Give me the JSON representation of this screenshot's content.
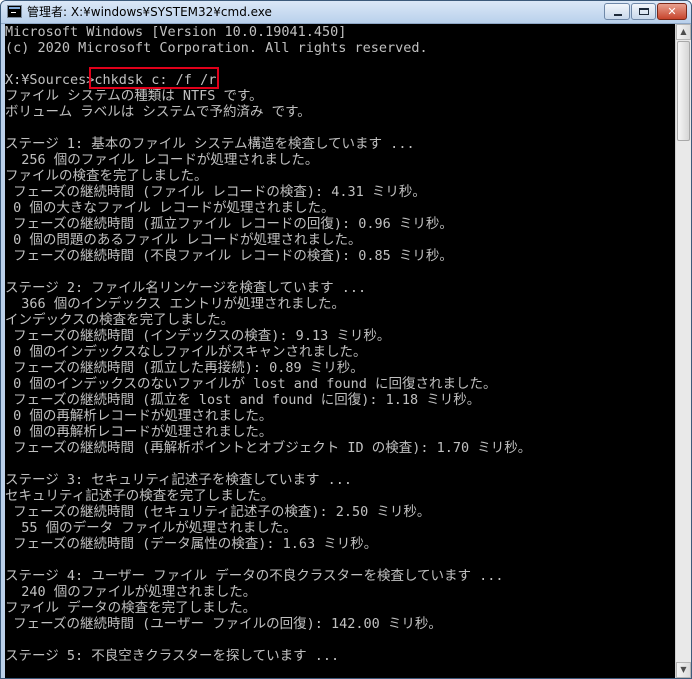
{
  "window": {
    "title": "管理者: X:¥windows¥SYSTEM32¥cmd.exe",
    "icon": "console-icon",
    "buttons": {
      "minimize": "minimize-icon",
      "maximize": "maximize-icon",
      "close": "close-icon",
      "close_glyph": "✕"
    }
  },
  "console": {
    "foreground": "#c0c0c0",
    "background": "#000000",
    "highlight_color": "#e0001a",
    "lines": [
      "Microsoft Windows [Version 10.0.19041.450]",
      "(c) 2020 Microsoft Corporation. All rights reserved.",
      "",
      "X:¥Sources>chkdsk c: /f /r",
      "ファイル システムの種類は NTFS です。",
      "ボリューム ラベルは システムで予約済み です。",
      "",
      "ステージ 1: 基本のファイル システム構造を検査しています ...",
      "  256 個のファイル レコードが処理されました。",
      "ファイルの検査を完了しました。",
      " フェーズの継続時間 (ファイル レコードの検査): 4.31 ミリ秒。",
      " 0 個の大きなファイル レコードが処理されました。",
      " フェーズの継続時間 (孤立ファイル レコードの回復): 0.96 ミリ秒。",
      " 0 個の問題のあるファイル レコードが処理されました。",
      " フェーズの継続時間 (不良ファイル レコードの検査): 0.85 ミリ秒。",
      "",
      "ステージ 2: ファイル名リンケージを検査しています ...",
      "  366 個のインデックス エントリが処理されました。",
      "インデックスの検査を完了しました。",
      " フェーズの継続時間 (インデックスの検査): 9.13 ミリ秒。",
      " 0 個のインデックスなしファイルがスキャンされました。",
      " フェーズの継続時間 (孤立した再接続): 0.89 ミリ秒。",
      " 0 個のインデックスのないファイルが lost and found に回復されました。",
      " フェーズの継続時間 (孤立を lost and found に回復): 1.18 ミリ秒。",
      " 0 個の再解析レコードが処理されました。",
      " 0 個の再解析レコードが処理されました。",
      " フェーズの継続時間 (再解析ポイントとオブジェクト ID の検査): 1.70 ミリ秒。",
      "",
      "ステージ 3: セキュリティ記述子を検査しています ...",
      "セキュリティ記述子の検査を完了しました。",
      " フェーズの継続時間 (セキュリティ記述子の検査): 2.50 ミリ秒。",
      "  55 個のデータ ファイルが処理されました。",
      " フェーズの継続時間 (データ属性の検査): 1.63 ミリ秒。",
      "",
      "ステージ 4: ユーザー ファイル データの不良クラスターを検査しています ...",
      "  240 個のファイルが処理されました。",
      "ファイル データの検査を完了しました。",
      " フェーズの継続時間 (ユーザー ファイルの回復): 142.00 ミリ秒。",
      "",
      "ステージ 5: 不良空きクラスターを探しています ..."
    ]
  },
  "scrollbar": {
    "up_glyph": "▲",
    "down_glyph": "▼"
  }
}
